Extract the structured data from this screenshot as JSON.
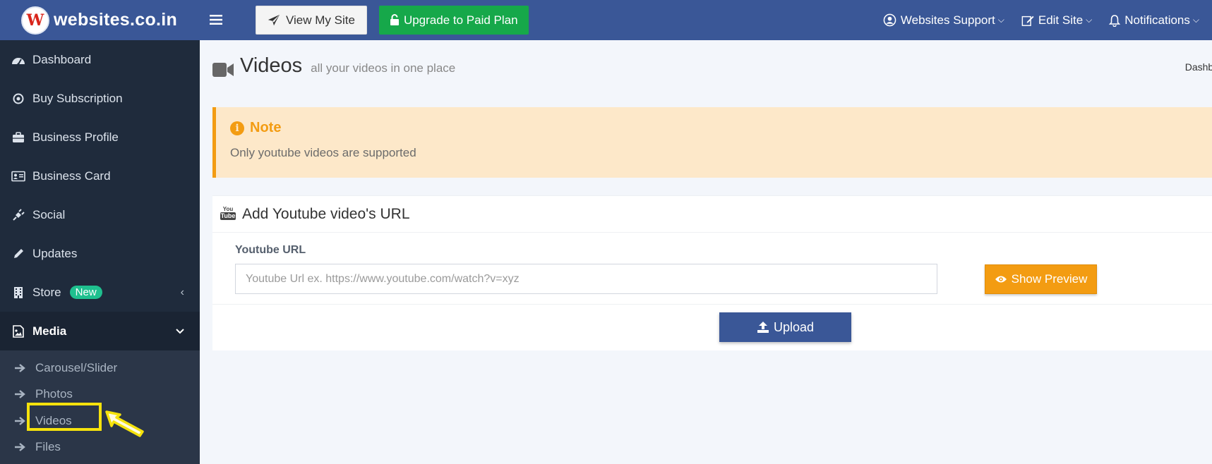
{
  "header": {
    "brand_logo_letter": "W",
    "brand_name": "websites.co.in",
    "view_site_label": "View My Site",
    "upgrade_label": "Upgrade to Paid Plan",
    "support_label": "Websites Support",
    "edit_site_label": "Edit Site",
    "notifications_label": "Notifications"
  },
  "sidebar": {
    "items": [
      {
        "label": "Dashboard",
        "icon": "dashboard-icon"
      },
      {
        "label": "Buy Subscription",
        "icon": "target-icon"
      },
      {
        "label": "Business Profile",
        "icon": "briefcase-icon"
      },
      {
        "label": "Business Card",
        "icon": "id-card-icon"
      },
      {
        "label": "Social",
        "icon": "plug-icon"
      },
      {
        "label": "Updates",
        "icon": "pencil-icon"
      },
      {
        "label": "Store",
        "icon": "building-icon",
        "badge": "New"
      },
      {
        "label": "Media",
        "icon": "image-icon",
        "expanded": true
      }
    ],
    "media_submenu": [
      {
        "label": "Carousel/Slider"
      },
      {
        "label": "Photos"
      },
      {
        "label": "Videos",
        "highlighted": true
      },
      {
        "label": "Files"
      }
    ]
  },
  "main": {
    "title": "Videos",
    "subtitle": "all your videos in one place",
    "breadcrumb": "Dashbo",
    "note": {
      "title": "Note",
      "text": "Only youtube videos are supported"
    },
    "card": {
      "icon_text_top": "You",
      "icon_text_bottom": "Tube",
      "title": "Add Youtube video's URL",
      "field_label": "Youtube URL",
      "url_placeholder": "Youtube Url ex. https://www.youtube.com/watch?v=xyz",
      "url_value": "",
      "preview_label": "Show Preview",
      "upload_label": "Upload"
    }
  },
  "colors": {
    "header_bg": "#3a5797",
    "sidebar_bg": "#1f2b3c",
    "upgrade_green": "#16a84a",
    "warning_orange": "#f39c12",
    "note_bg": "#fde8c9",
    "badge_teal": "#1fc08f",
    "highlight_yellow": "#f5e20c"
  }
}
